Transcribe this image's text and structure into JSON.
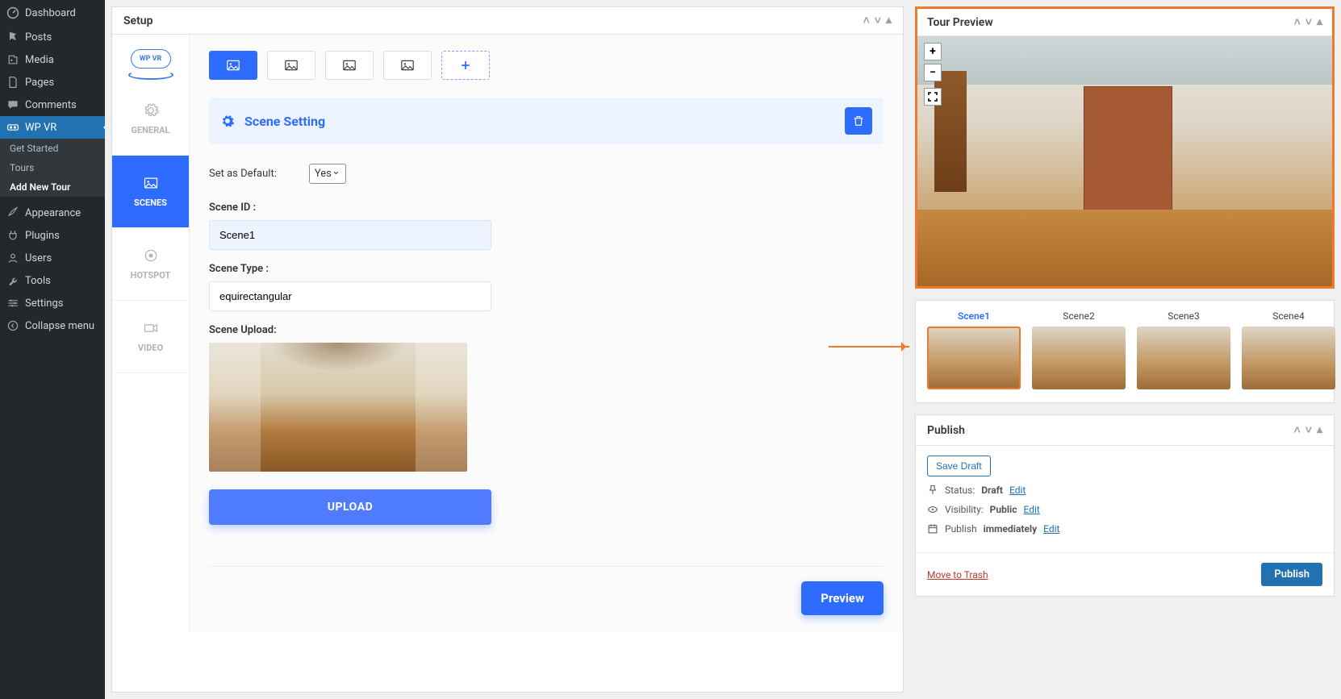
{
  "sidebar": {
    "dashboard": "Dashboard",
    "posts": "Posts",
    "media": "Media",
    "pages": "Pages",
    "comments": "Comments",
    "wpvr": "WP VR",
    "wpvr_sub": {
      "get_started": "Get Started",
      "tours": "Tours",
      "add_new_tour": "Add New Tour"
    },
    "appearance": "Appearance",
    "plugins": "Plugins",
    "users": "Users",
    "tools": "Tools",
    "settings": "Settings",
    "collapse": "Collapse menu"
  },
  "setup": {
    "title": "Setup",
    "logo_text": "WP VR",
    "nav": {
      "general": "GENERAL",
      "scenes": "SCENES",
      "hotspot": "HOTSPOT",
      "video": "VIDEO"
    },
    "scene_setting": "Scene Setting",
    "set_default_label": "Set as Default:",
    "set_default_value": "Yes",
    "scene_id_label": "Scene ID :",
    "scene_id_value": "Scene1",
    "scene_type_label": "Scene Type :",
    "scene_type_value": "equirectangular",
    "scene_upload_label": "Scene Upload:",
    "upload_btn": "UPLOAD",
    "preview_btn": "Preview"
  },
  "preview": {
    "title": "Tour Preview",
    "zoom_in": "+",
    "zoom_out": "−",
    "scenes": [
      "Scene1",
      "Scene2",
      "Scene3",
      "Scene4"
    ]
  },
  "publish": {
    "title": "Publish",
    "save_draft": "Save Draft",
    "status_label": "Status:",
    "status_value": "Draft",
    "visibility_label": "Visibility:",
    "visibility_value": "Public",
    "pub_label": "Publish",
    "pub_value": "immediately",
    "edit": "Edit",
    "move_trash": "Move to Trash",
    "publish_btn": "Publish"
  }
}
